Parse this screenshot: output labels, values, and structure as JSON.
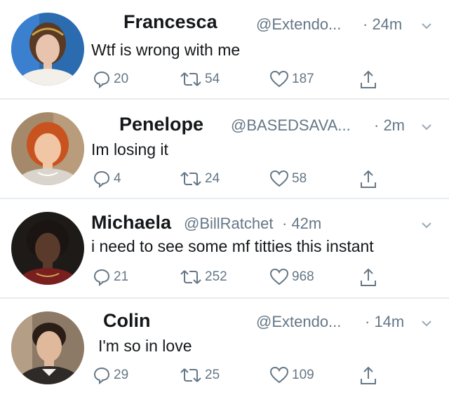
{
  "tweets": [
    {
      "name": "Francesca",
      "handle": "@Extendo...",
      "time": "· 24m",
      "text": "Wtf is wrong with me",
      "replies": "20",
      "retweets": "54",
      "likes": "187",
      "avatar_colors": {
        "bg": "#2b6cb0",
        "hair": "#5a3a22",
        "skin": "#e8c4ae",
        "dress": "#f3efe9"
      }
    },
    {
      "name": "Penelope",
      "handle": "@BASEDSAVA...",
      "time": "· 2m",
      "text": "Im losing it",
      "replies": "4",
      "retweets": "24",
      "likes": "58",
      "avatar_colors": {
        "bg": "#a48a6a",
        "hair": "#c8531f",
        "skin": "#f0c6a4",
        "dress": "#d9d4cc"
      }
    },
    {
      "name": "Michaela",
      "handle": "@BillRatchet",
      "time": "· 42m",
      "text": "i need to see some mf titties this instant",
      "replies": "21",
      "retweets": "252",
      "likes": "968",
      "avatar_colors": {
        "bg": "#1e1a18",
        "hair": "#1a1412",
        "skin": "#5a3a2a",
        "dress": "#7a1f1f"
      }
    },
    {
      "name": "Colin",
      "handle": "@Extendo...",
      "time": "· 14m",
      "text": "I'm so in love",
      "replies": "29",
      "retweets": "25",
      "likes": "109",
      "avatar_colors": {
        "bg": "#8c7a66",
        "hair": "#2a1d16",
        "skin": "#e0b89c",
        "dress": "#2e2a28"
      }
    }
  ],
  "colors": {
    "text": "#14171a",
    "secondary": "#657786",
    "separator": "#e6ecf0"
  },
  "icons": {
    "reply": "reply-icon",
    "retweet": "retweet-icon",
    "like": "like-icon",
    "share": "share-icon",
    "menu": "chevron-down-icon"
  }
}
